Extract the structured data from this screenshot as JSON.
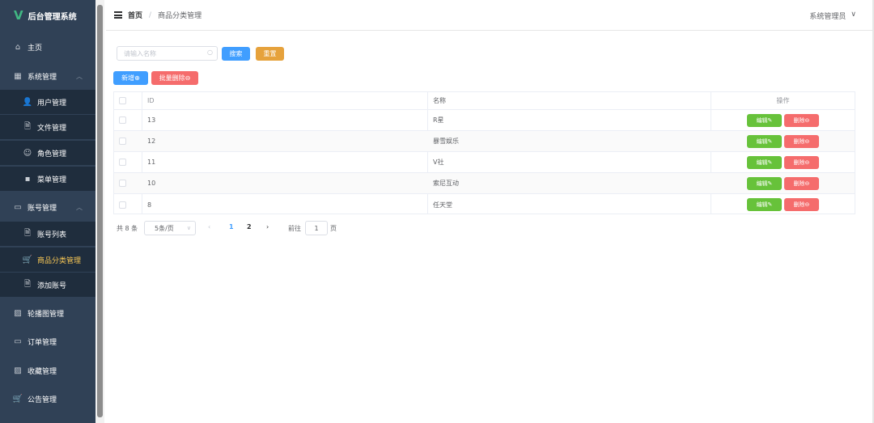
{
  "app": {
    "title": "后台管理系统",
    "logo": "V"
  },
  "sidebar": {
    "items": [
      {
        "label": "主页",
        "icon": "home-icon",
        "glyph": "⌂"
      },
      {
        "label": "系统管理",
        "icon": "grid-icon",
        "glyph": "▦"
      },
      {
        "label": "用户管理",
        "icon": "user-icon",
        "glyph": "👤"
      },
      {
        "label": "文件管理",
        "icon": "document-icon",
        "glyph": "🗎"
      },
      {
        "label": "角色管理",
        "icon": "person-icon",
        "glyph": "☺"
      },
      {
        "label": "菜单管理",
        "icon": "menu-grid-icon",
        "glyph": "▪"
      },
      {
        "label": "账号管理",
        "icon": "briefcase-icon",
        "glyph": "▭"
      },
      {
        "label": "账号列表",
        "icon": "list-icon",
        "glyph": "🗎"
      },
      {
        "label": "商品分类管理",
        "icon": "cart-icon",
        "glyph": "🛒"
      },
      {
        "label": "添加账号",
        "icon": "add-document-icon",
        "glyph": "🗎"
      },
      {
        "label": "轮播图管理",
        "icon": "picture-icon",
        "glyph": "▨"
      },
      {
        "label": "订单管理",
        "icon": "bag-icon",
        "glyph": "▭"
      },
      {
        "label": "收藏管理",
        "icon": "picture-icon",
        "glyph": "▨"
      },
      {
        "label": "公告管理",
        "icon": "cart-icon",
        "glyph": "🛒"
      }
    ]
  },
  "header": {
    "breadcrumb_home": "首页",
    "breadcrumb_sep": "/",
    "breadcrumb_current": "商品分类管理",
    "user": "系统管理员",
    "user_chevron": "∨"
  },
  "search": {
    "placeholder": "请输入名称",
    "search_label": "搜索",
    "reset_label": "重置"
  },
  "actions": {
    "add_label": "新增⊕",
    "batch_delete_label": "批量删除⊖"
  },
  "table": {
    "headers": {
      "id": "ID",
      "name": "名称",
      "ops": "操作"
    },
    "edit_label": "编辑✎",
    "delete_label": "删除⊖",
    "rows": [
      {
        "id": "13",
        "name": "R星"
      },
      {
        "id": "12",
        "name": "暴雪娱乐"
      },
      {
        "id": "11",
        "name": "V社"
      },
      {
        "id": "10",
        "name": "索尼互动"
      },
      {
        "id": "8",
        "name": "任天堂"
      }
    ]
  },
  "pagination": {
    "total": "共 8 条",
    "page_size": "5条/页",
    "prev": "‹",
    "next": "›",
    "pages": [
      "1",
      "2"
    ],
    "goto_label": "前往",
    "goto_value": "1",
    "goto_unit": "页"
  },
  "colors": {
    "sidebar_bg": "#304156",
    "active": "#f9c855",
    "primary": "#409eff",
    "warning": "#e6a23c",
    "danger": "#f56c6c",
    "success": "#67c23a"
  }
}
